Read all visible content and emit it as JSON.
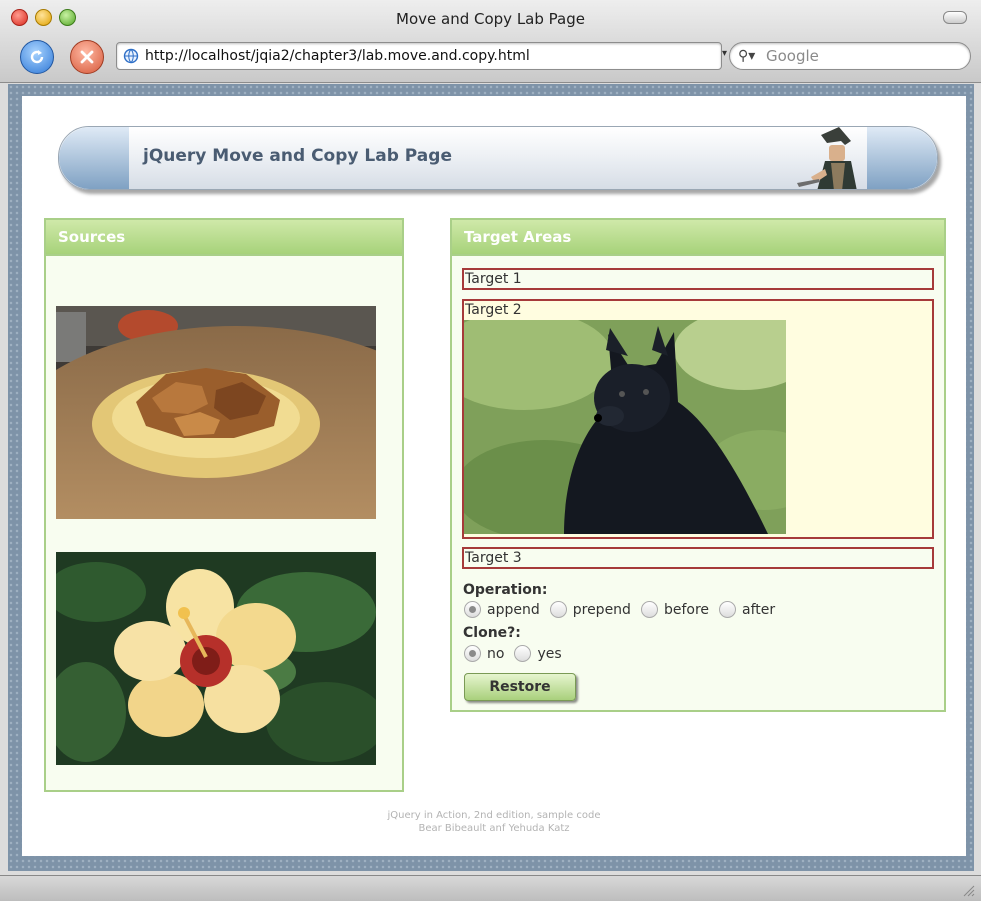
{
  "window": {
    "title": "Move and Copy Lab Page"
  },
  "toolbar": {
    "url": "http://localhost/jqia2/chapter3/lab.move.and.copy.html",
    "search_placeholder": "Google"
  },
  "page": {
    "banner_title": "jQuery Move and Copy Lab Page",
    "sources": {
      "title": "Sources",
      "images": [
        "bread-pudding-photo",
        "hibiscus-flower-photo"
      ]
    },
    "targets": {
      "title": "Target Areas",
      "items": [
        {
          "label": "Target 1"
        },
        {
          "label": "Target 2",
          "content": "dog-photo"
        },
        {
          "label": "Target 3"
        }
      ],
      "operation_label": "Operation:",
      "operations": [
        "append",
        "prepend",
        "before",
        "after"
      ],
      "operation_selected": "append",
      "clone_label": "Clone?:",
      "clone_options": [
        "no",
        "yes"
      ],
      "clone_selected": "no",
      "restore_label": "Restore"
    },
    "footer_line1": "jQuery in Action, 2nd edition, sample code",
    "footer_line2": "Bear Bibeault anf Yehuda Katz"
  },
  "colors": {
    "panel_header": "#a7d27a",
    "panel_border": "#a9cf88",
    "panel_bg": "#f8fdf0",
    "target_border": "#a63a3a",
    "banner_text": "#4a5c72"
  }
}
